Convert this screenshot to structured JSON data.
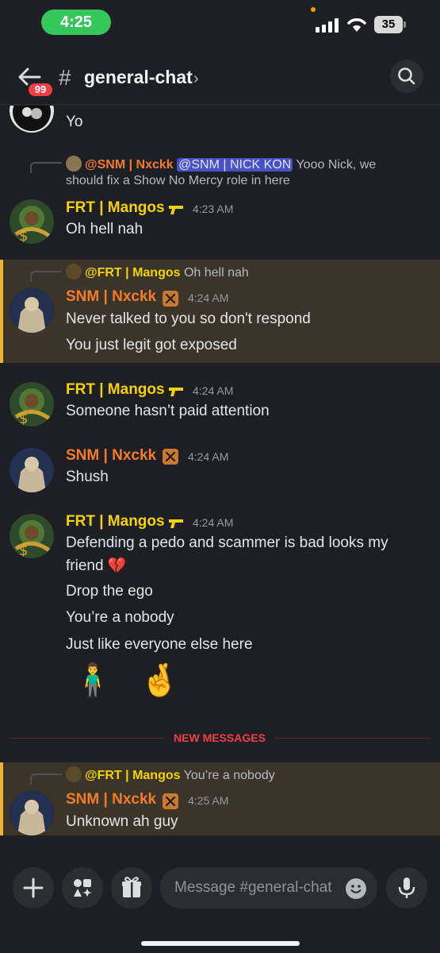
{
  "status_bar": {
    "time": "4:25",
    "battery": "35"
  },
  "header": {
    "unread_count": "99",
    "hash": "#",
    "channel_name": "general-chat",
    "chevron": "›"
  },
  "messages": {
    "m0": {
      "text": "Yo"
    },
    "m1": {
      "reply": {
        "name": "@SNM | Nxckk",
        "mention": "@SNM | NICK KON",
        "text_1": " Yooo Nick, we",
        "text_2": "should fix a Show No Mercy role in here"
      },
      "author": "FRT | Mangos",
      "time": "4:23 AM",
      "lines": [
        "Oh hell nah"
      ]
    },
    "m2": {
      "reply": {
        "name": "@FRT | Mangos",
        "text": " Oh hell nah"
      },
      "author": "SNM | Nxckk",
      "time": "4:24 AM",
      "lines": [
        "Never talked to you so don't respond",
        "You just legit got exposed"
      ]
    },
    "m3": {
      "author": "FRT | Mangos",
      "time": "4:24 AM",
      "lines": [
        "Someone hasn’t paid attention"
      ]
    },
    "m4": {
      "author": "SNM | Nxckk",
      "time": "4:24 AM",
      "lines": [
        "Shush"
      ]
    },
    "m5": {
      "author": "FRT | Mangos",
      "time": "4:24 AM",
      "lines": [
        "Defending a pedo and scammer is bad looks my",
        "friend 💔",
        "Drop the ego",
        "You’re a nobody",
        "Just like everyone else here"
      ],
      "emojis": "🧍‍♂️ 🤞"
    },
    "divider": "NEW MESSAGES",
    "m6": {
      "reply": {
        "name": "@FRT | Mangos",
        "text": " You’re a nobody"
      },
      "author": "SNM | Nxckk",
      "time": "4:25 AM",
      "lines": [
        "Unknown ah guy"
      ]
    }
  },
  "composer": {
    "placeholder": "Message #general-chat"
  },
  "colors": {
    "accent_yellow": "#f5d300",
    "accent_orange": "#f47b2a",
    "highlight": "#f0b232",
    "new_messages": "#f23f43",
    "mention_bg": "#4752c4"
  }
}
